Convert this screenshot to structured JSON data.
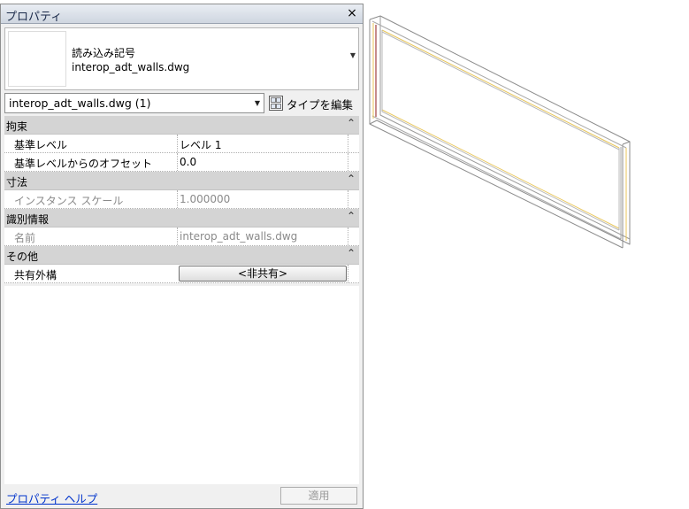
{
  "palette": {
    "title": "プロパティ",
    "close_glyph": "×",
    "type_family": "読み込み記号",
    "type_name": "interop_adt_walls.dwg",
    "instance_selector": "interop_adt_walls.dwg (1)",
    "edit_type_label": "タイプを編集"
  },
  "groups": [
    {
      "label": "拘束",
      "rows": [
        {
          "name": "基準レベル",
          "value": "レベル 1"
        },
        {
          "name": "基準レベルからのオフセット",
          "value": "0.0"
        }
      ]
    },
    {
      "label": "寸法",
      "rows": [
        {
          "name": "インスタンス スケール",
          "value": "1.000000"
        }
      ]
    },
    {
      "label": "識別情報",
      "rows": [
        {
          "name": "名前",
          "value": "interop_adt_walls.dwg"
        }
      ]
    },
    {
      "label": "その他",
      "rows": [
        {
          "name": "共有外構",
          "value": "<非共有>"
        }
      ]
    }
  ],
  "collapse_glyph": "⌃",
  "footer": {
    "help_link": "プロパティ ヘルプ",
    "apply_label": "適用"
  },
  "colors": {
    "group_header": "#d4d4d4",
    "link": "#0033cc",
    "wall_outline": "#808080",
    "wall_highlight": "#e8c65a",
    "wall_edge_red": "#8b1a1a"
  }
}
